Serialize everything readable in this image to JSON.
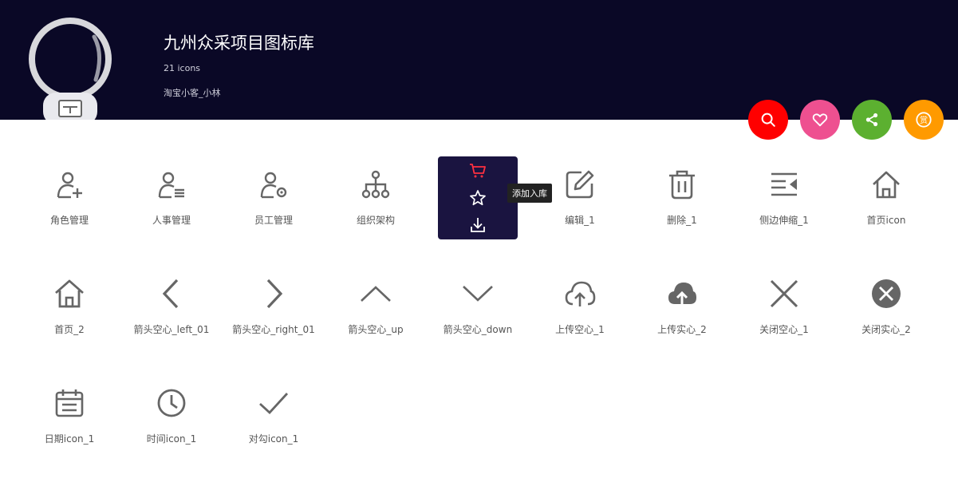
{
  "header": {
    "title": "九州众采项目图标库",
    "icon_count": "21 icons",
    "author": "淘宝小客_小林"
  },
  "actions": {
    "search": {
      "color": "#ff0000",
      "icon": "search-icon"
    },
    "favorite": {
      "color": "#ee5090",
      "icon": "heart-icon"
    },
    "share": {
      "color": "#5cb030",
      "icon": "share-icon"
    },
    "reward": {
      "color": "#ff9a00",
      "icon": "reward-icon"
    }
  },
  "hover": {
    "tooltip": "添加入库",
    "actions": [
      "cart-icon",
      "star-icon",
      "download-icon"
    ]
  },
  "icons": [
    {
      "label": "角色管理",
      "icon": "user-add-icon"
    },
    {
      "label": "人事管理",
      "icon": "user-list-icon"
    },
    {
      "label": "员工管理",
      "icon": "user-settings-icon"
    },
    {
      "label": "组织架构",
      "icon": "org-chart-icon"
    },
    {
      "label": "",
      "icon": "hidden-icon"
    },
    {
      "label": "编辑_1",
      "icon": "edit-icon"
    },
    {
      "label": "删除_1",
      "icon": "trash-icon"
    },
    {
      "label": "侧边伸缩_1",
      "icon": "sidebar-collapse-icon"
    },
    {
      "label": "首页icon",
      "icon": "home-outline-icon"
    },
    {
      "label": "首页_2",
      "icon": "home-icon"
    },
    {
      "label": "箭头空心_left_01",
      "icon": "chevron-left-icon"
    },
    {
      "label": "箭头空心_right_01",
      "icon": "chevron-right-icon"
    },
    {
      "label": "箭头空心_up",
      "icon": "chevron-up-icon"
    },
    {
      "label": "箭头空心_down",
      "icon": "chevron-down-icon"
    },
    {
      "label": "上传空心_1",
      "icon": "cloud-upload-outline-icon"
    },
    {
      "label": "上传实心_2",
      "icon": "cloud-upload-solid-icon"
    },
    {
      "label": "关闭空心_1",
      "icon": "close-outline-icon"
    },
    {
      "label": "关闭实心_2",
      "icon": "close-solid-icon"
    },
    {
      "label": "日期icon_1",
      "icon": "calendar-icon"
    },
    {
      "label": "时间icon_1",
      "icon": "clock-icon"
    },
    {
      "label": "对勾icon_1",
      "icon": "check-icon"
    }
  ]
}
